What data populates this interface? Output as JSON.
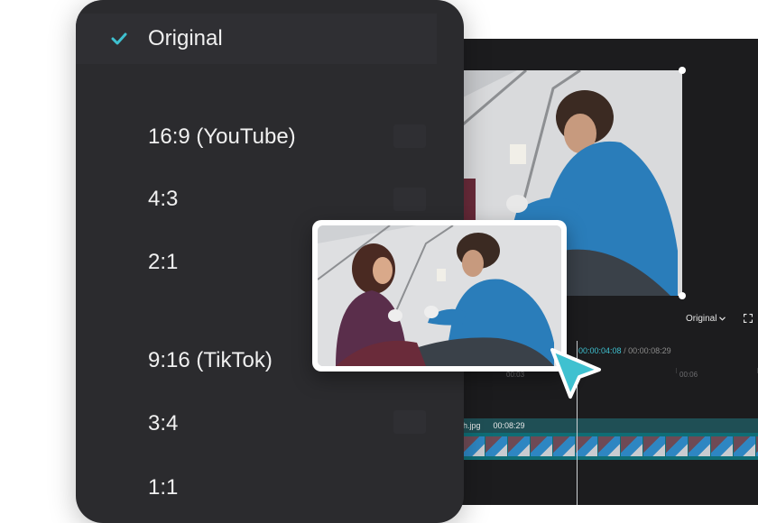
{
  "menu": {
    "items": [
      {
        "label": "Original",
        "selected": true
      },
      {
        "label": "16:9 (YouTube)",
        "selected": false
      },
      {
        "label": "4:3",
        "selected": false
      },
      {
        "label": "2:1",
        "selected": false
      },
      {
        "label": "9:16 (TikTok)",
        "selected": false
      },
      {
        "label": "3:4",
        "selected": false
      },
      {
        "label": "1:1",
        "selected": false
      }
    ]
  },
  "editor": {
    "aspect_select": "Original",
    "timecode_current": "00:00:04:08",
    "timecode_separator": "/",
    "timecode_total": "00:00:08:29",
    "ruler_labels": [
      "00:03",
      "00:06"
    ],
    "clip_name": "h.jpg",
    "clip_duration": "00:08:29"
  },
  "colors": {
    "accent": "#3fc1d0",
    "menu_bg": "#2b2b2e",
    "editor_bg": "#1c1c1e",
    "clip_track": "#0f6d75"
  },
  "icons": {
    "check": "check-icon",
    "aspect_chevron": "chevron-down-icon",
    "fullscreen": "fullscreen-icon",
    "cursor": "pointer-cursor-icon"
  }
}
